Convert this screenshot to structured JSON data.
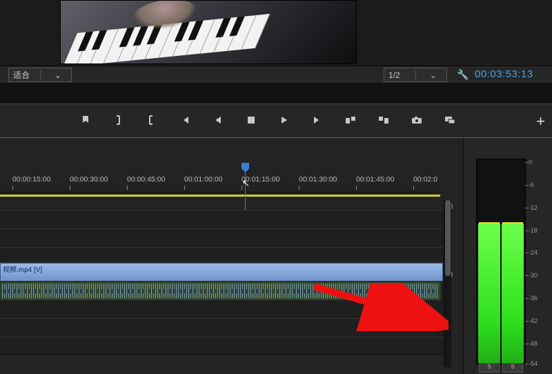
{
  "toolbar": {
    "zoom_label": "适合",
    "resolution_label": "1/2",
    "timecode": "00:03:53:13"
  },
  "transport": {
    "icons": [
      "marker",
      "in-bracket",
      "out-bracket",
      "goto-in",
      "step-back",
      "play-stop",
      "step-fwd",
      "goto-out",
      "lift",
      "extract",
      "snapshot",
      "overwrite"
    ]
  },
  "ruler": {
    "ticks": [
      "00:00:15:00",
      "00:00:30:00",
      "00:00:45:00",
      "00:01:00:00",
      "00:01:15:00",
      "00:01:30:00",
      "00:01:45:00",
      "00:02:0"
    ]
  },
  "clip": {
    "video_label": "视频.mp4 [V]"
  },
  "meter": {
    "scale": [
      "0",
      "-6",
      "-12",
      "-18",
      "-24",
      "-30",
      "-36",
      "-42",
      "-48",
      "-54"
    ],
    "solo": "S"
  }
}
